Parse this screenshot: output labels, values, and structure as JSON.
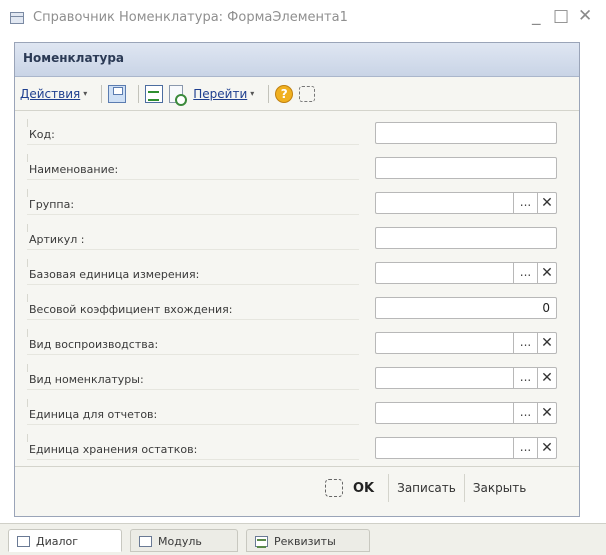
{
  "window": {
    "title": "Справочник Номенклатура: ФормаЭлемента1",
    "icon": "form-icon",
    "controls": {
      "minimize": "_",
      "maximize": "□",
      "close": "✕"
    }
  },
  "form": {
    "header": "Номенклатура",
    "toolbar": {
      "actions_label": "Действия",
      "goto_label": "Перейти",
      "dropdown_arrow": "▾",
      "help_glyph": "?",
      "icons": [
        "save-and-close-icon",
        "table-icon",
        "copy-document-icon",
        "help-icon",
        "customize-icon"
      ]
    },
    "fields": [
      {
        "label": "Код:",
        "value": "",
        "has_buttons": false
      },
      {
        "label": "Наименование:",
        "value": "",
        "has_buttons": false
      },
      {
        "label": "Группа:",
        "value": "",
        "has_buttons": true
      },
      {
        "label": "Артикул :",
        "value": "",
        "has_buttons": false
      },
      {
        "label": "Базовая единица измерения:",
        "value": "",
        "has_buttons": true
      },
      {
        "label": "Весовой коэффициент вхождения:",
        "value": "0",
        "has_buttons": false
      },
      {
        "label": "Вид воспроизводства:",
        "value": "",
        "has_buttons": true
      },
      {
        "label": "Вид номенклатуры:",
        "value": "",
        "has_buttons": true
      },
      {
        "label": "Единица для отчетов:",
        "value": "",
        "has_buttons": true
      },
      {
        "label": "Единица хранения остатков:",
        "value": "",
        "has_buttons": true
      }
    ],
    "field_buttons": {
      "choose": "...",
      "clear": "✕"
    },
    "footer": {
      "ok": "OK",
      "save": "Записать",
      "close": "Закрыть"
    }
  },
  "tabs": [
    {
      "label": "Диалог",
      "active": true
    },
    {
      "label": "Модуль",
      "active": false
    },
    {
      "label": "Реквизиты",
      "active": false
    }
  ]
}
